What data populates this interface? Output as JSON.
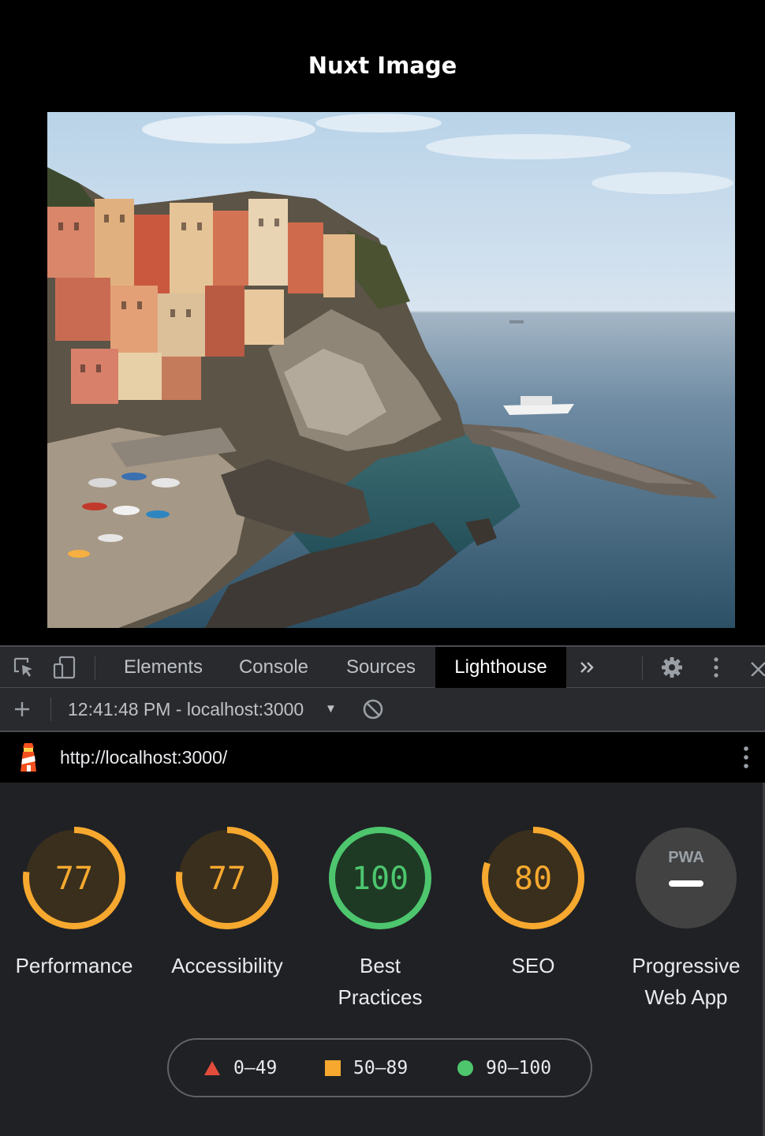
{
  "page": {
    "title": "Nuxt Image"
  },
  "devtools": {
    "tabs": [
      {
        "label": "Elements"
      },
      {
        "label": "Console"
      },
      {
        "label": "Sources"
      },
      {
        "label": "Lighthouse"
      }
    ],
    "active_tab": "Lighthouse",
    "icons": [
      "inspect-element-icon",
      "device-toolbar-icon",
      "more-tabs-chevron-icon",
      "gear-icon",
      "kebab-menu-icon",
      "close-icon"
    ]
  },
  "lighthouse_bar": {
    "report_selector": "12:41:48 PM - localhost:3000",
    "caret": "▼"
  },
  "url_bar": {
    "url": "http://localhost:3000/"
  },
  "scores": [
    {
      "value": 77,
      "display": "77",
      "label": "Performance",
      "status": "average"
    },
    {
      "value": 77,
      "display": "77",
      "label": "Accessibility",
      "status": "average"
    },
    {
      "value": 100,
      "display": "100",
      "label": "Best Practices",
      "status": "pass"
    },
    {
      "value": 80,
      "display": "80",
      "label": "SEO",
      "status": "average"
    },
    {
      "value": null,
      "display": "PWA",
      "label": "Progressive Web App",
      "status": "na"
    }
  ],
  "legend": [
    {
      "range": "0–49",
      "shape": "triangle",
      "color": "#e44d3c"
    },
    {
      "range": "50–89",
      "shape": "square",
      "color": "#f7a92f"
    },
    {
      "range": "90–100",
      "shape": "circle",
      "color": "#4dc66e"
    }
  ],
  "colors": {
    "average": "#f7a92f",
    "average_bg": "#3a2f1d",
    "pass": "#4dc66e",
    "pass_bg": "#1e3a24",
    "na_bg": "#424242",
    "lighthouse_orange": "#f4511e"
  }
}
